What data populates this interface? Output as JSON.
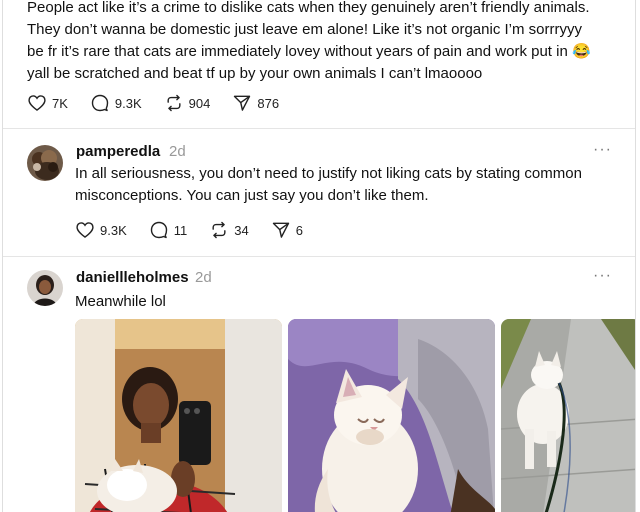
{
  "post1": {
    "text": "People act like it’s a crime to dislike cats when they genuinely aren’t friendly animals.\nThey don’t wanna be domestic just leave em alone! Like it’s not organic I’m sorrryyy\nbe fr it’s rare that cats are immediately lovey without years of pain and work put in 😂\nyall be scratched and beat tf up by your own animals I can’t lmaoooo",
    "likes": "7K",
    "replies": "9.3K",
    "reposts": "904",
    "shares": "876"
  },
  "post2": {
    "username": "pamperedla",
    "time": "2d",
    "text": "In all seriousness, you don’t need to justify not liking cats by stating common\nmisconceptions. You can just say you don’t like them.",
    "likes": "9.3K",
    "replies": "11",
    "reposts": "34",
    "shares": "6",
    "more": "···"
  },
  "post3": {
    "username": "daniellleholmes",
    "time": "2d",
    "text": "Meanwhile lol",
    "more": "···"
  }
}
